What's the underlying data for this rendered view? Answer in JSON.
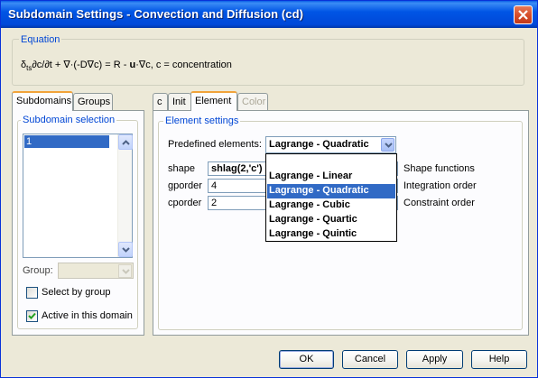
{
  "window": {
    "title": "Subdomain Settings - Convection and Diffusion (cd)"
  },
  "equation": {
    "legend": "Equation",
    "prefix": "δ",
    "sub": "ts",
    "body": "∂c/∂t + ∇·(-D∇c) = R - ",
    "u": "u",
    "suffix": "·∇c, c = concentration"
  },
  "left_tabs": {
    "subdomains": "Subdomains",
    "groups": "Groups"
  },
  "subdomain_selection": {
    "legend": "Subdomain selection",
    "items": [
      "1"
    ],
    "group_label": "Group:",
    "group_value": "",
    "select_by_group": {
      "label": "Select by group",
      "checked": false
    },
    "active_in_domain": {
      "label": "Active in this domain",
      "checked": true
    }
  },
  "right_tabs": {
    "c": "c",
    "init": "Init",
    "element": "Element",
    "color": "Color"
  },
  "element_settings": {
    "legend": "Element settings",
    "predefined_label": "Predefined elements:",
    "predefined_value": "Lagrange - Quadratic",
    "dropdown_options": [
      "",
      "Lagrange - Linear",
      "Lagrange - Quadratic",
      "Lagrange - Cubic",
      "Lagrange - Quartic",
      "Lagrange - Quintic"
    ],
    "dropdown_selected_index": 2,
    "rows": [
      {
        "name": "shape",
        "value": "shlag(2,'c')",
        "desc": "Shape functions"
      },
      {
        "name": "gporder",
        "value": "4",
        "desc": "Integration order"
      },
      {
        "name": "cporder",
        "value": "2",
        "desc": "Constraint order"
      }
    ]
  },
  "buttons": {
    "ok": "OK",
    "cancel": "Cancel",
    "apply": "Apply",
    "help": "Help"
  },
  "colors": {
    "title_bar": "#0055e5",
    "selection": "#316ac5",
    "legend_text": "#0046d5",
    "tab_highlight": "#f1a33a"
  }
}
